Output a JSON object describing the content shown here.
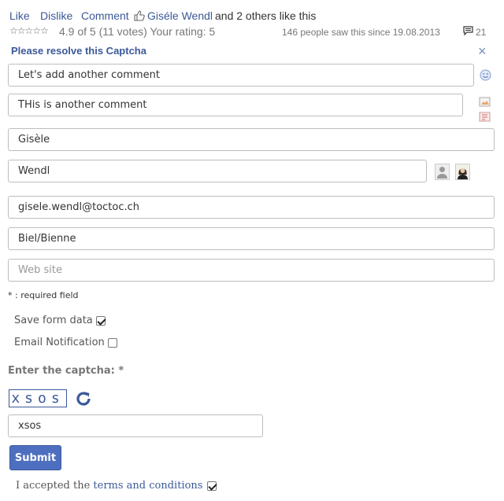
{
  "actions": {
    "like": "Like",
    "dislike": "Dislike",
    "comment": "Comment",
    "liker_name": "Giséle Wendl",
    "likes_suffix": "and 2 others like this"
  },
  "rating": {
    "stars_text": "☆☆☆☆☆",
    "summary": "4.9 of 5 (11 votes) Your rating: 5",
    "views_text": "146 people saw this since 19.08.2013",
    "comment_count": "21"
  },
  "captcha_panel": {
    "title": "Please resolve this Captcha",
    "close_symbol": "×"
  },
  "form": {
    "comment1": "Let's add another comment",
    "comment2": "THis is another comment",
    "first_name": "Gisèle",
    "last_name": "Wendl",
    "email": "gisele.wendl@toctoc.ch",
    "city": "Biel/Bienne",
    "website_placeholder": "Web site",
    "required_note": "* : required field",
    "save_form_label": "Save form data",
    "save_form_checked": true,
    "email_notification_label": "Email Notification",
    "email_notification_checked": false,
    "enter_captcha_label": "Enter the captcha: *",
    "captcha_text": "xsos",
    "captcha_value": "xsos",
    "submit_label": "Submit",
    "terms_prefix": "I accepted the",
    "terms_link": "terms and conditions",
    "terms_checked": true
  },
  "colors": {
    "link": "#3b5998",
    "submit_bg": "#4e6fc0"
  }
}
